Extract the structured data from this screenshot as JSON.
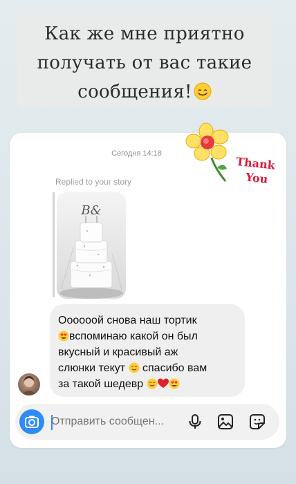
{
  "caption": {
    "line1": "Как же мне приятно",
    "line2": "получать от вас такие",
    "line3": "сообщения!"
  },
  "sticker": {
    "line1": "Thank",
    "line2": "You"
  },
  "chat": {
    "timestamp": "Сегодня 14:18",
    "replied_label": "Replied to your story",
    "message": {
      "line1": "Оооооой снова наш тортик",
      "line2": "вспоминаю какой он был",
      "line3": "вкусный и красивый аж",
      "line4_a": "слюнки текут",
      "line4_b": "спасибо вам",
      "line5": "за такой шедевр"
    }
  },
  "composer": {
    "placeholder": "Отправить сообщен..."
  },
  "icons": [
    "camera-icon",
    "microphone-icon",
    "gallery-icon",
    "sticker-icon",
    "smiling-face-emoji",
    "heart-eyes-emoji",
    "red-heart-emoji",
    "flower-sticker"
  ],
  "colors": {
    "accent": "#2f8cf5",
    "bubble": "#efefef",
    "sticker_red": "#d81b3a"
  }
}
